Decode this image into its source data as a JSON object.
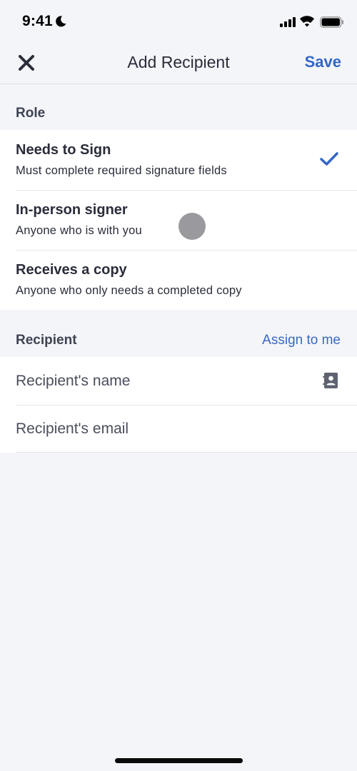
{
  "status_bar": {
    "time": "9:41",
    "icons": [
      "moon-icon",
      "signal-icon",
      "wifi-icon",
      "battery-icon"
    ]
  },
  "nav": {
    "title": "Add Recipient",
    "close_icon": "close-icon",
    "save_label": "Save"
  },
  "role_section": {
    "title": "Role",
    "options": [
      {
        "title": "Needs to Sign",
        "description": "Must complete required signature fields",
        "selected": true
      },
      {
        "title": "In-person signer",
        "description": "Anyone who is with you",
        "selected": false
      },
      {
        "title": "Receives a copy",
        "description": "Anyone who only needs a completed copy",
        "selected": false
      }
    ]
  },
  "recipient_section": {
    "title": "Recipient",
    "action_label": "Assign to me",
    "name_field": {
      "value": "",
      "placeholder": "Recipient's name",
      "icon": "contacts-icon"
    },
    "email_field": {
      "value": "",
      "placeholder": "Recipient's email"
    }
  },
  "colors": {
    "accent": "#3366c4",
    "background": "#f4f5f9",
    "surface": "#ffffff",
    "text": "#2a2d3a"
  }
}
